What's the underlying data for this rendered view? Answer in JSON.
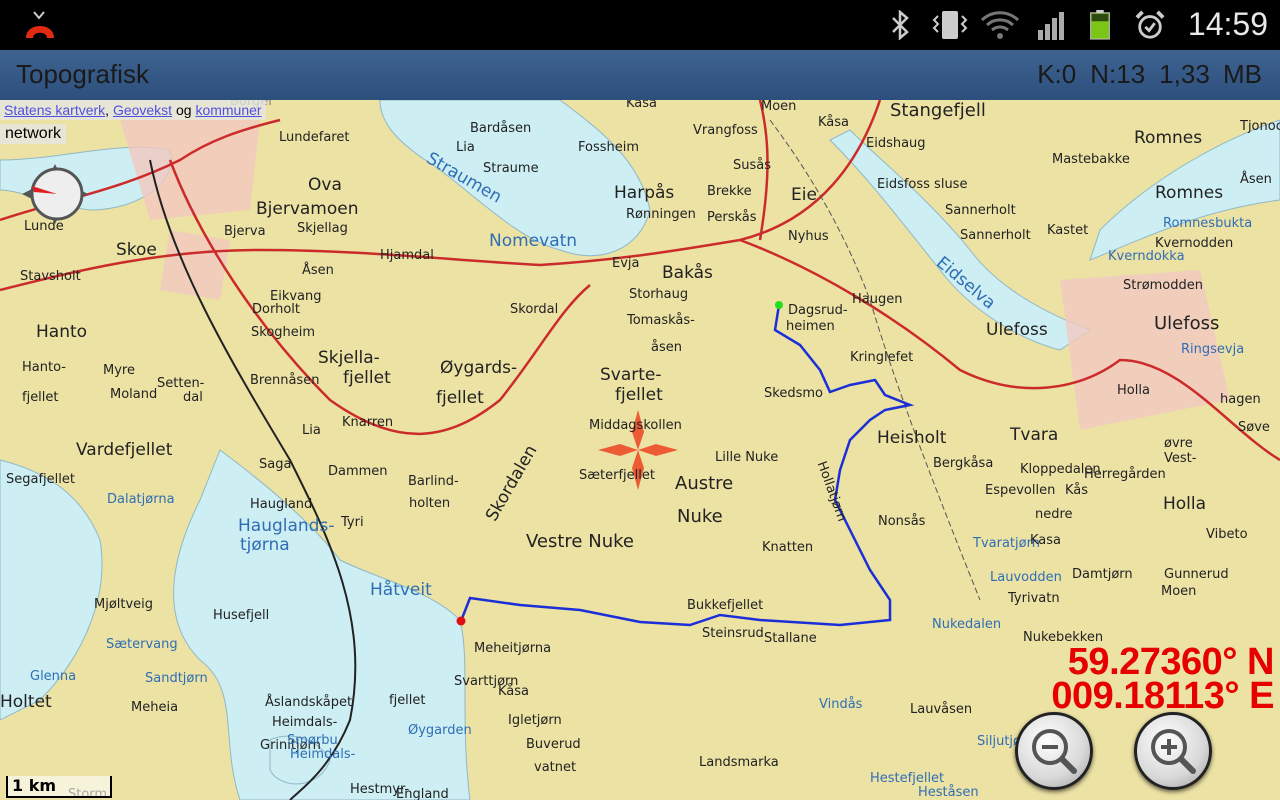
{
  "status_bar": {
    "time": "14:59",
    "icons": [
      "missed-call-icon",
      "bluetooth-icon",
      "vibrate-icon",
      "wifi-icon",
      "signal-icon",
      "battery-icon",
      "alarm-icon"
    ]
  },
  "title_bar": {
    "title": "Topografisk",
    "k": "K:0",
    "n": "N:13",
    "size": "1,33 MB"
  },
  "attribution": {
    "link1": "Statens kartverk",
    "sep": ",",
    "link2": "Geovekst",
    "og": "og",
    "link3": "kommuner",
    "network": "network"
  },
  "coordinates": {
    "lat": "59.27360° N",
    "lon": "009.18113° E"
  },
  "scale": "1 km",
  "colors": {
    "track": "#1a2fd8",
    "coords": "#e60000",
    "land": "#ece2a4",
    "water": "#cdeef3"
  },
  "map": {
    "labels": [
      "Kåsa",
      "Moen",
      "Stangefjell",
      "Kåsa",
      "Romnes",
      "Tjonoc",
      "Bardåsen",
      "Lia",
      "Vrangfoss",
      "Fossheim",
      "Eidshaug",
      "Mastebakke",
      "Lundefaret",
      "Straume",
      "Susås",
      "Eidsfoss sluse",
      "Romnes",
      "Ova",
      "Straumen",
      "Harpås",
      "Brekke",
      "Eie",
      "Bjervamoen",
      "Rønningen",
      "Perskås",
      "Sannerholt",
      "Sannerholt",
      "Kastet",
      "Romnesbukta",
      "Skoe",
      "Skjellag",
      "Nomevatn",
      "Nyhus",
      "Kvernodden",
      "Bjerva",
      "Hjamdal",
      "Evja",
      "Bakås",
      "Kverndokka",
      "Åsen",
      "Eidselva",
      "Strømodden",
      "Stavsholt",
      "Storhaug",
      "Haugen",
      "Eikvang",
      "Skordal",
      "Dagsrud-",
      "heimen",
      "Ulefoss",
      "Ulefoss",
      "Hanto",
      "Dorholt",
      "Skogheim",
      "Tomaskås-",
      "åsen",
      "Kringlefet",
      "Ringsevja",
      "Hanto-",
      "fjellet",
      "Myre",
      "Skjella-",
      "fjellet",
      "Øygards-",
      "fjellet",
      "Svarte-",
      "fjellet",
      "Skedsmo",
      "Holla",
      "Moland",
      "Setten-",
      "dal",
      "Brennåsen",
      "Knarren",
      "Middagskollen",
      "Heisholt",
      "Tvara",
      "Lia",
      "Vardefjellet",
      "Lille Nuke",
      "Bergkåsa",
      "Herregården",
      "Saga",
      "Dammen",
      "Barlind-",
      "holten",
      "Sæterfjellet",
      "Austre",
      "Nuke",
      "Espevollen",
      "Kås",
      "Segafjellet",
      "Haugland",
      "Nonsås",
      "Holla",
      "Dalatjørna",
      "Skordalen",
      "Hauglands-",
      "tjørna",
      "Tyri",
      "Vestre Nuke",
      "Knatten",
      "Tvaratjørn",
      "Vibeto",
      "Lauvodden",
      "Damtjørn",
      "Gunnerud",
      "Håtveit",
      "Tyrivatn",
      "Moen",
      "Mjøltveig",
      "Husefjell",
      "Bukkefjellet",
      "Nukedalen",
      "Nukebekken",
      "Steinsrud",
      "Stallane",
      "Sætervang",
      "Meheitjørna",
      "Glenna",
      "Sandtjørn",
      "Svarttjørn",
      "Kåsa",
      "Holtet",
      "Meheia",
      "Åslandskåpet",
      "Heimdals-",
      "fjellet",
      "Lauvåsen",
      "Vindås",
      "Igletjørn",
      "Buverud",
      "Øygarden",
      "Grinitjørn",
      "Smørbu",
      "Heimdals-",
      "vatnet",
      "Landsmarka",
      "Hestefjellet",
      "Siljutjørn",
      "Storm",
      "Hestmyr-",
      "England",
      "Heståsen",
      "Hollatjørn",
      "Kloppedalen",
      "nedre",
      "øvre",
      "Vest-",
      "hagen",
      "Søve",
      "Borger",
      "Lunde",
      "Åsen",
      "Kasa",
      "Vardefjellet"
    ]
  }
}
